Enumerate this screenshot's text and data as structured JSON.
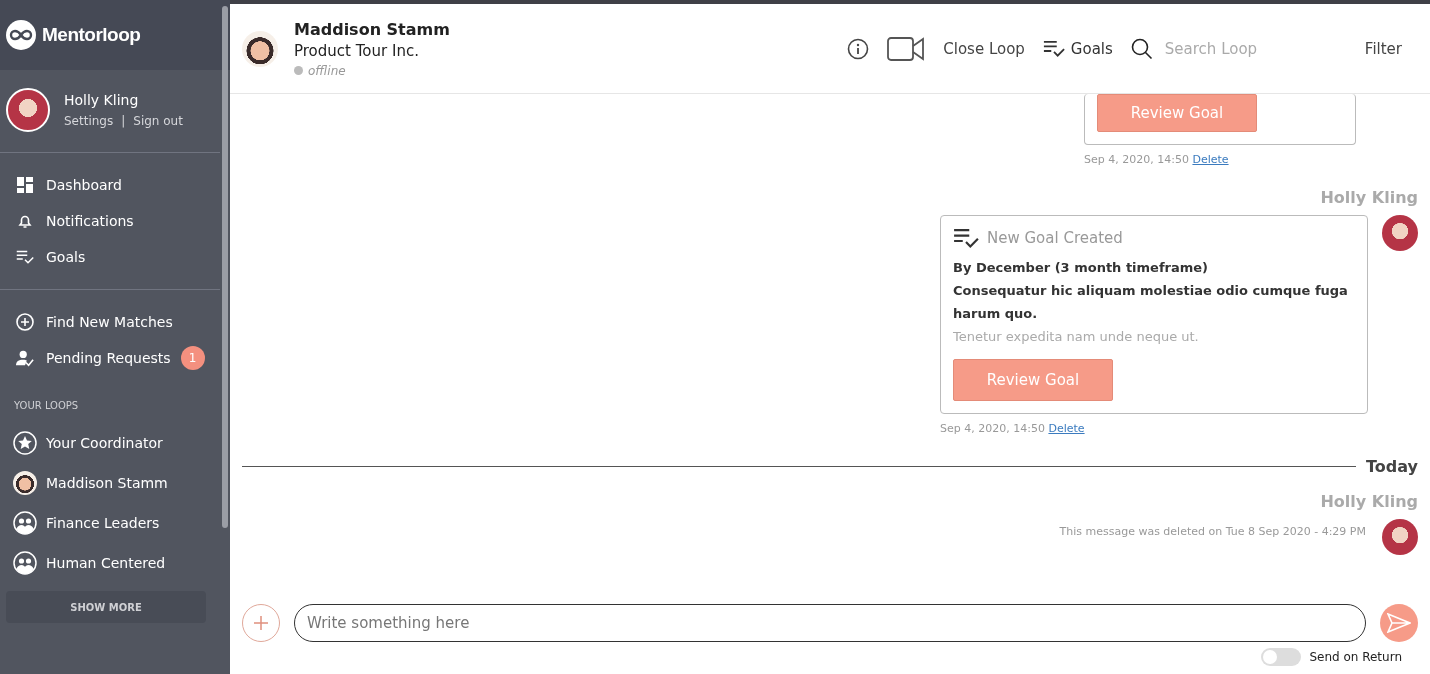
{
  "sidebar": {
    "logo": "Mentorloop",
    "user": {
      "name": "Holly Kling",
      "links": [
        "Settings",
        "Sign out"
      ],
      "separator": "|"
    },
    "nav": [
      {
        "kind": "dashboard",
        "label": "Dashboard"
      },
      {
        "kind": "bell",
        "label": "Notifications"
      },
      {
        "kind": "goals",
        "label": "Goals"
      }
    ],
    "actions": [
      {
        "kind": "plus",
        "label": "Find New Matches"
      },
      {
        "kind": "person",
        "label": "Pending Requests",
        "badge": "1"
      }
    ],
    "loops_heading": "YOUR LOOPS",
    "loops": [
      {
        "kind": "star",
        "label": "Your Coordinator"
      },
      {
        "kind": "avatar",
        "label": "Maddison Stamm"
      },
      {
        "kind": "group",
        "label": "Finance Leaders"
      },
      {
        "kind": "group",
        "label": "Human Centered"
      }
    ],
    "show_more": "SHOW MORE"
  },
  "header": {
    "name": "Maddison Stamm",
    "company": "Product Tour Inc.",
    "status": "offline",
    "online": false,
    "close_loop": "Close Loop",
    "goals": "Goals",
    "search_placeholder": "Search Loop",
    "filter": "Filter"
  },
  "messages": [
    {
      "kind": "goal_partial",
      "button": "Review Goal",
      "timestamp": "Sep 4, 2020, 14:50",
      "delete": "Delete"
    },
    {
      "kind": "goal",
      "author": "Holly Kling",
      "title": "New Goal Created",
      "deadline": "By December (3 month timeframe)",
      "description": "Consequatur hic aliquam molestiae odio cumque fuga harum quo.",
      "note": "Tenetur expedita nam unde neque ut.",
      "button": "Review Goal",
      "timestamp": "Sep 4, 2020, 14:50",
      "delete": "Delete"
    },
    {
      "kind": "divider",
      "label": "Today"
    },
    {
      "kind": "deleted",
      "author": "Holly Kling",
      "text": "This message was deleted on Tue 8 Sep 2020 - 4:29 PM"
    }
  ],
  "composer": {
    "placeholder": "Write something here",
    "toggle_label": "Send on Return",
    "on": false
  }
}
